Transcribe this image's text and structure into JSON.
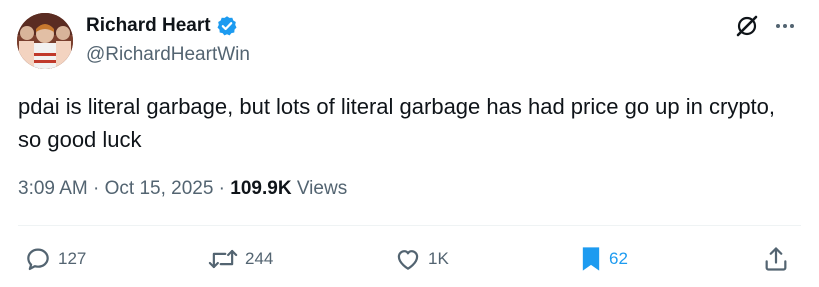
{
  "author": {
    "display_name": "Richard Heart",
    "handle": "@RichardHeartWin",
    "verified": true
  },
  "tweet": {
    "text": "pdai is literal garbage, but lots of literal garbage has had price go up in crypto, so good luck"
  },
  "meta": {
    "time": "3:09 AM",
    "sep1": " · ",
    "date": "Oct 15, 2025",
    "sep2": " · ",
    "views_count": "109.9K",
    "views_label": " Views"
  },
  "actions": {
    "replies": "127",
    "reposts": "244",
    "likes": "1K",
    "bookmarks": "62"
  },
  "colors": {
    "text": "#0f1419",
    "secondary": "#536471",
    "accent": "#1d9bf0"
  },
  "icons": [
    "verified-badge-icon",
    "grok-icon",
    "more-icon",
    "reply-icon",
    "repost-icon",
    "like-icon",
    "bookmark-icon",
    "share-icon"
  ]
}
